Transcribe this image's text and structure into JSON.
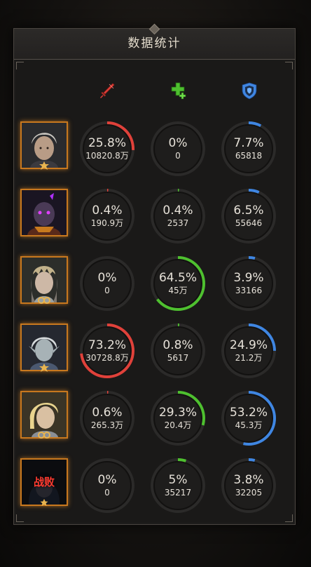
{
  "title": "数据统计",
  "columns": [
    {
      "icon": "sword-damage-icon",
      "color": "#e0413a"
    },
    {
      "icon": "heal-cross-icon",
      "color": "#4ec02f"
    },
    {
      "icon": "shield-icon",
      "color": "#3f86e2"
    }
  ],
  "rows": [
    {
      "hero": "hero-silver-hair-warrior",
      "defeated": false,
      "defeat_label": "",
      "stats": [
        {
          "pct": "25.8%",
          "value": "10820.8万",
          "fraction": 0.258
        },
        {
          "pct": "0%",
          "value": "0",
          "fraction": 0
        },
        {
          "pct": "7.7%",
          "value": "65818",
          "fraction": 0.077
        }
      ]
    },
    {
      "hero": "hero-dark-demon",
      "defeated": false,
      "defeat_label": "",
      "stats": [
        {
          "pct": "0.4%",
          "value": "190.9万",
          "fraction": 0.004
        },
        {
          "pct": "0.4%",
          "value": "2537",
          "fraction": 0.004
        },
        {
          "pct": "6.5%",
          "value": "55646",
          "fraction": 0.065
        }
      ]
    },
    {
      "hero": "hero-crowned-priestess",
      "defeated": false,
      "defeat_label": "",
      "stats": [
        {
          "pct": "0%",
          "value": "0",
          "fraction": 0
        },
        {
          "pct": "64.5%",
          "value": "45万",
          "fraction": 0.645
        },
        {
          "pct": "3.9%",
          "value": "33166",
          "fraction": 0.039
        }
      ]
    },
    {
      "hero": "hero-elf-mage",
      "defeated": false,
      "defeat_label": "",
      "stats": [
        {
          "pct": "73.2%",
          "value": "30728.8万",
          "fraction": 0.732
        },
        {
          "pct": "0.8%",
          "value": "5617",
          "fraction": 0.008
        },
        {
          "pct": "24.9%",
          "value": "21.2万",
          "fraction": 0.249
        }
      ]
    },
    {
      "hero": "hero-blonde-knight",
      "defeated": false,
      "defeat_label": "",
      "stats": [
        {
          "pct": "0.6%",
          "value": "265.3万",
          "fraction": 0.006
        },
        {
          "pct": "29.3%",
          "value": "20.4万",
          "fraction": 0.293
        },
        {
          "pct": "53.2%",
          "value": "45.3万",
          "fraction": 0.532
        }
      ]
    },
    {
      "hero": "hero-hooded-assassin",
      "defeated": true,
      "defeat_label": "战败",
      "stats": [
        {
          "pct": "0%",
          "value": "0",
          "fraction": 0
        },
        {
          "pct": "5%",
          "value": "35217",
          "fraction": 0.05
        },
        {
          "pct": "3.8%",
          "value": "32205",
          "fraction": 0.038
        }
      ]
    }
  ]
}
